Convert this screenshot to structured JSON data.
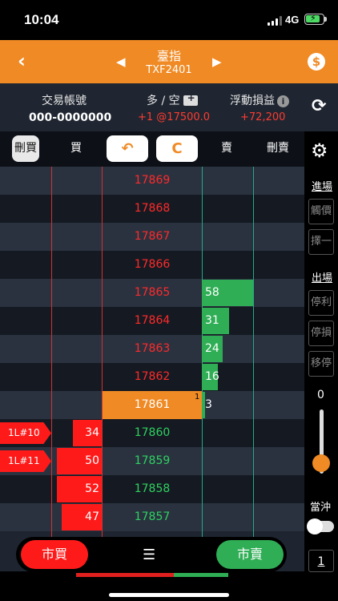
{
  "status": {
    "time": "10:04",
    "network": "4G"
  },
  "header": {
    "back": "‹",
    "prev": "◀",
    "next": "▶",
    "title": "臺指",
    "code": "TXF2401",
    "currency_icon": "$"
  },
  "account": {
    "acct_label": "交易帳號",
    "acct_value": "000-0000000",
    "pos_label": "多 / 空",
    "pos_value": "+1 @17500.0",
    "pnl_label": "浮動損益",
    "pnl_value": "+72,200"
  },
  "controls": {
    "del_buy": "刪買",
    "buy": "買",
    "undo": "↶",
    "refresh": "C",
    "sell": "賣",
    "del_sell": "刪賣"
  },
  "side": {
    "entry_label": "進場",
    "trigger": "觸價",
    "choose": "擇一",
    "exit_label": "出場",
    "take_profit": "停利",
    "stop_loss": "停損",
    "trailing": "移停",
    "slider_value": "0",
    "daytrade": "當沖",
    "qty": "1"
  },
  "ladder": {
    "prices": [
      "17869",
      "17868",
      "17867",
      "17866",
      "17865",
      "17864",
      "17863",
      "17862",
      "17861",
      "17860",
      "17859",
      "17858",
      "17857"
    ],
    "asks": [
      {
        "row": 4,
        "qty": "58",
        "w": 64
      },
      {
        "row": 5,
        "qty": "31",
        "w": 34
      },
      {
        "row": 6,
        "qty": "24",
        "w": 26
      },
      {
        "row": 7,
        "qty": "16",
        "w": 20
      },
      {
        "row": 8,
        "qty": "3",
        "w": 4
      }
    ],
    "bids": [
      {
        "row": 9,
        "qty": "34",
        "w": 36
      },
      {
        "row": 10,
        "qty": "50",
        "w": 56
      },
      {
        "row": 11,
        "qty": "52",
        "w": 56
      },
      {
        "row": 12,
        "qty": "47",
        "w": 50
      }
    ],
    "tags": [
      {
        "row": 9,
        "text": "1L#10"
      },
      {
        "row": 10,
        "text": "1L#11"
      }
    ],
    "last_fill_marker": "1"
  },
  "bottom": {
    "market_buy": "市買",
    "market_sell": "市賣",
    "list_icon": "☰"
  },
  "colors": {
    "accent": "#f08a24",
    "red": "#ff1a1a",
    "green": "#2fae55"
  }
}
